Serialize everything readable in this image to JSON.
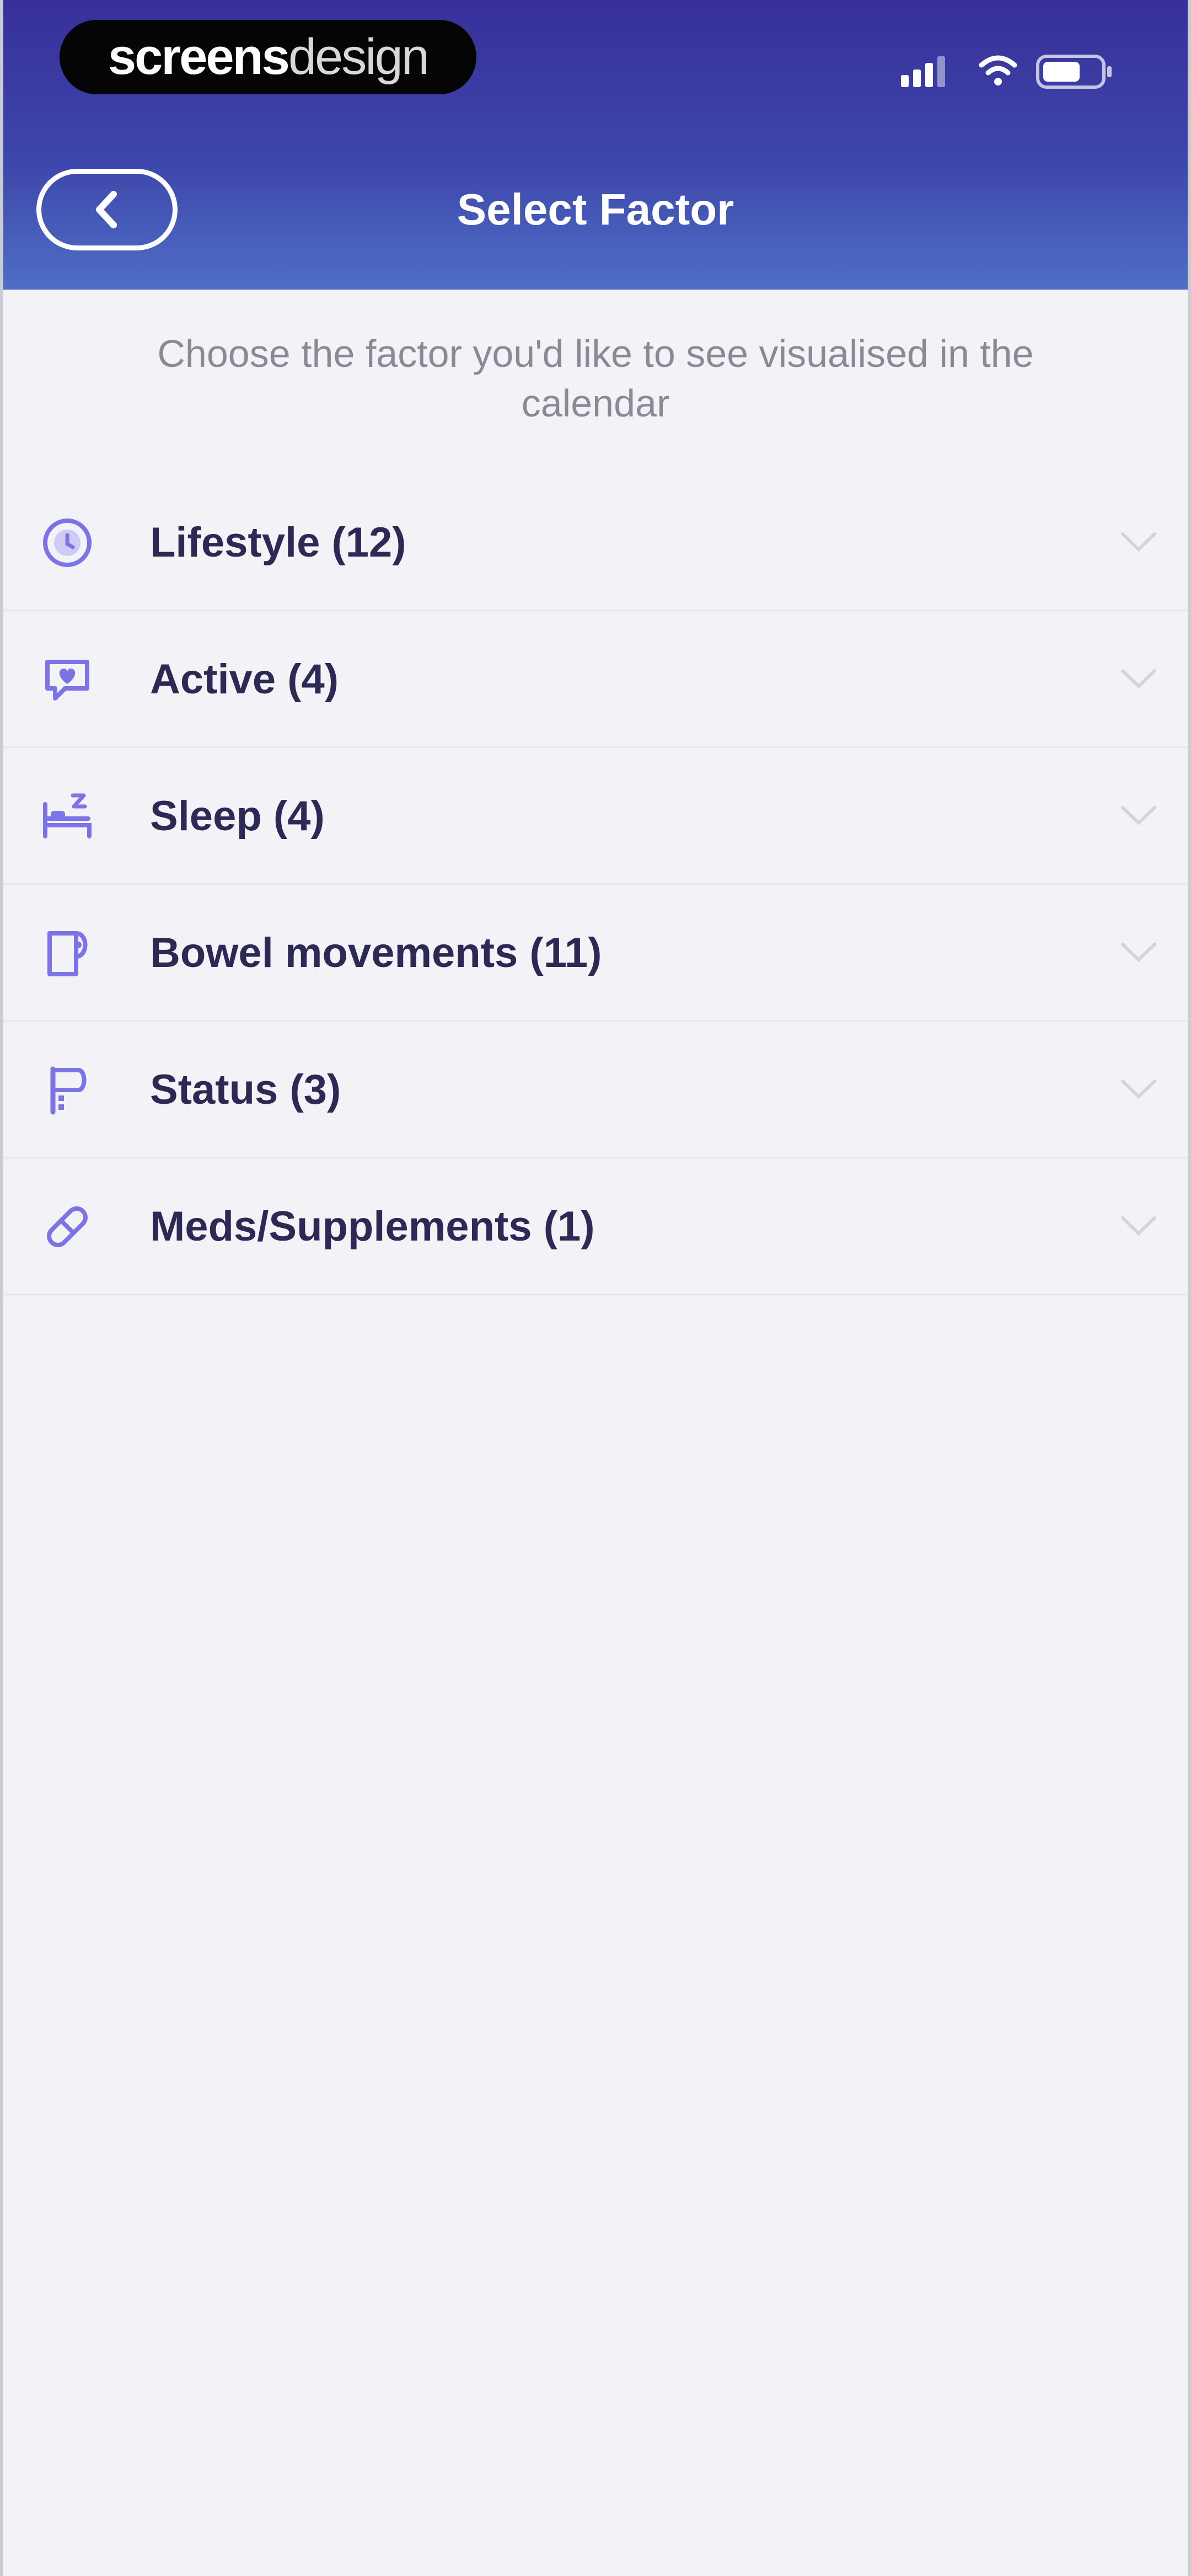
{
  "status_bar": {
    "logo": {
      "bold": "screens",
      "light": "design"
    }
  },
  "nav": {
    "title": "Select Factor"
  },
  "subtitle": "Choose the factor you'd like to see visualised in the calendar",
  "factors": [
    {
      "label": "Lifestyle (12)",
      "icon": "clock-icon"
    },
    {
      "label": "Active (4)",
      "icon": "heart-chat-icon"
    },
    {
      "label": "Sleep (4)",
      "icon": "bed-icon"
    },
    {
      "label": "Bowel movements (11)",
      "icon": "toilet-paper-icon"
    },
    {
      "label": "Status (3)",
      "icon": "flag-icon"
    },
    {
      "label": "Meds/Supplements (1)",
      "icon": "pill-icon"
    }
  ],
  "colors": {
    "header_top": "#38309a",
    "header_bottom": "#4e6ec6",
    "icon_accent": "#7b73e6",
    "label": "#2c2a55",
    "background": "#f2f2f7"
  }
}
